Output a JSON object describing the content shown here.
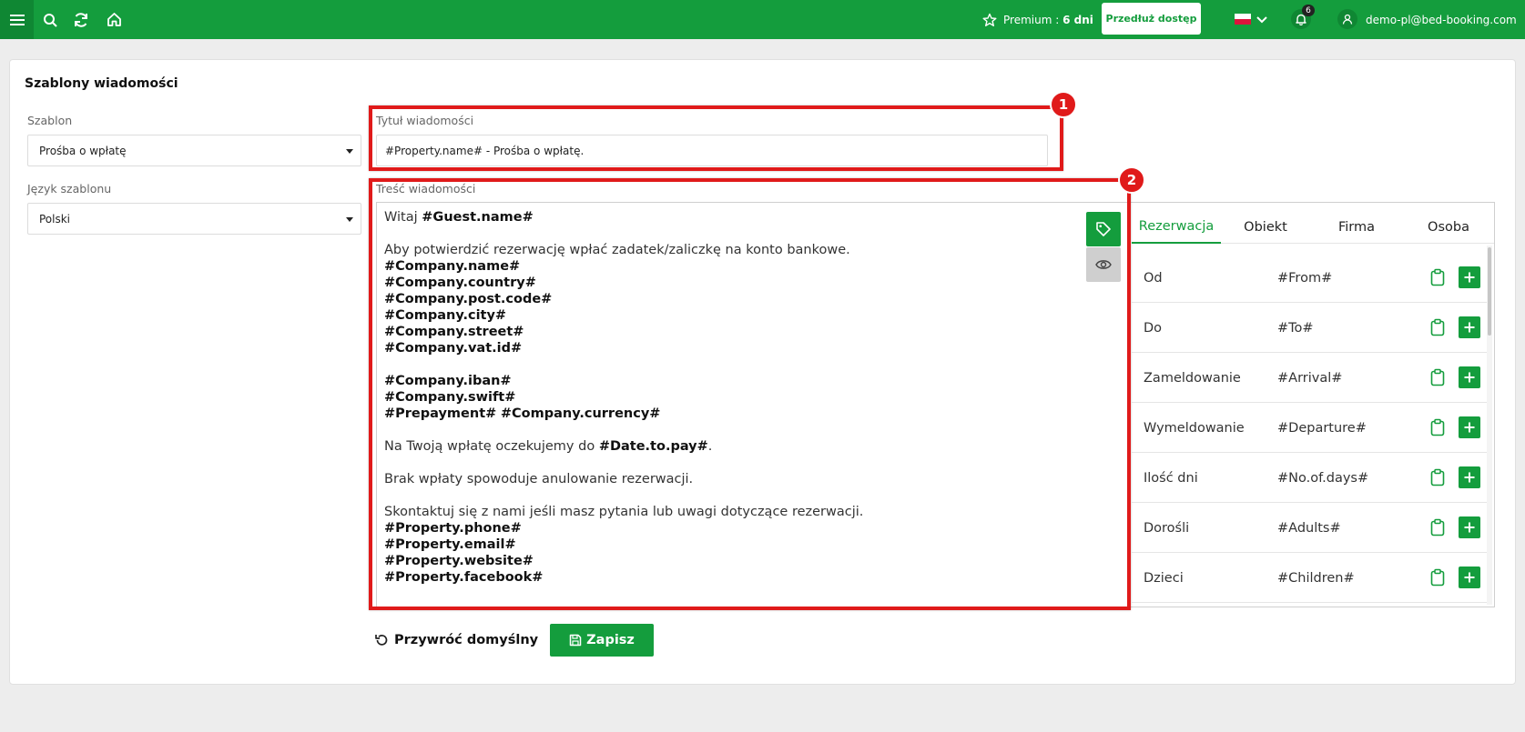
{
  "topbar": {
    "premium_label": "Premium :",
    "premium_value": "6 dni",
    "extend_label": "Przedłuż dostęp",
    "notifications_count": "6",
    "user_email": "demo-pl@bed-booking.com",
    "brand_color": "#149d3d"
  },
  "page": {
    "title": "Szablony wiadomości"
  },
  "form": {
    "template_label": "Szablon",
    "template_value": "Prośba o wpłatę",
    "language_label": "Język szablonu",
    "language_value": "Polski",
    "subject_label": "Tytuł wiadomości",
    "subject_value": "#Property.name# - Prośba o wpłatę.",
    "body_label": "Treść wiadomości"
  },
  "body_text": {
    "l1_a": "Witaj ",
    "l1_b": "#Guest.name#",
    "l2": "Aby potwierdzić rezerwację wpłać zadatek/zaliczkę na konto bankowe.",
    "l3": "#Company.name#",
    "l4": "#Company.country#",
    "l5": "#Company.post.code#",
    "l6": "#Company.city#",
    "l7": "#Company.street#",
    "l8": "#Company.vat.id#",
    "l9": "#Company.iban#",
    "l10": "#Company.swift#",
    "l11_a": "#Prepayment#",
    "l11_b": "#Company.currency#",
    "l12_a": "Na Twoją wpłatę oczekujemy do ",
    "l12_b": "#Date.to.pay#",
    "l12_c": ".",
    "l13": "Brak wpłaty spowoduje anulowanie rezerwacji.",
    "l14": "Skontaktuj się z nami jeśli masz pytania lub uwagi dotyczące rezerwacji.",
    "l15": "#Property.phone#",
    "l16": "#Property.email#",
    "l17": "#Property.website#",
    "l18": "#Property.facebook#"
  },
  "annotations": {
    "badge1": "1",
    "badge2": "2",
    "color": "#e01a1a"
  },
  "tabs": [
    "Rezerwacja",
    "Obiekt",
    "Firma",
    "Osoba"
  ],
  "variables": [
    {
      "label": "Od",
      "tag": "#From#"
    },
    {
      "label": "Do",
      "tag": "#To#"
    },
    {
      "label": "Zameldowanie",
      "tag": "#Arrival#"
    },
    {
      "label": "Wymeldowanie",
      "tag": "#Departure#"
    },
    {
      "label": "Ilość dni",
      "tag": "#No.of.days#"
    },
    {
      "label": "Dorośli",
      "tag": "#Adults#"
    },
    {
      "label": "Dzieci",
      "tag": "#Children#"
    }
  ],
  "actions": {
    "restore_label": "Przywróć domyślny",
    "save_label": "Zapisz"
  }
}
